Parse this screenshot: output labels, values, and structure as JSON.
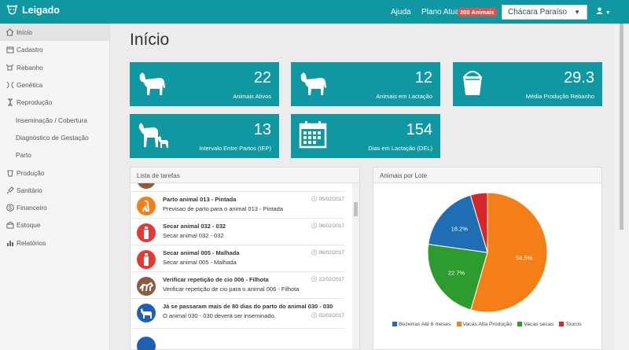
{
  "topbar": {
    "app_name": "Leigado",
    "help": "Ajuda",
    "plan_label": "Plano Atual:",
    "plan_badge": "200 Animais",
    "farm_selected": "Chácara Paraíso"
  },
  "sidebar": {
    "items": [
      {
        "label": "Início",
        "icon": "home-icon"
      },
      {
        "label": "Cadastro",
        "icon": "register-icon"
      },
      {
        "label": "Rebanho",
        "icon": "herd-icon"
      },
      {
        "label": "Genética",
        "icon": "genetics-icon"
      },
      {
        "label": "Reprodução",
        "icon": "reproduction-icon"
      },
      {
        "label": "Inseminação / Cobertura"
      },
      {
        "label": "Diagnóstico de Gestação"
      },
      {
        "label": "Parto"
      },
      {
        "label": "Produção",
        "icon": "production-icon"
      },
      {
        "label": "Sanitário",
        "icon": "syringe-icon"
      },
      {
        "label": "Financeiro",
        "icon": "dollar-icon"
      },
      {
        "label": "Estoque",
        "icon": "stock-icon"
      },
      {
        "label": "Relatórios",
        "icon": "reports-icon"
      }
    ]
  },
  "main": {
    "title": "Início",
    "cards": [
      {
        "value": "22",
        "label": "Animais Ativos",
        "icon": "cow-icon"
      },
      {
        "value": "12",
        "label": "Animais em Lactação",
        "icon": "cow-icon"
      },
      {
        "value": "29.3",
        "label": "Média Produção Rebanho",
        "icon": "bucket-icon"
      },
      {
        "value": "13",
        "label": "Intervalo Entre Partos (IEP)",
        "icon": "cow-calf-icon"
      },
      {
        "value": "154",
        "label": "Dias em Lactação (DEL)",
        "icon": "calendar-icon"
      }
    ]
  },
  "tasks": {
    "title": "Lista de tarefas",
    "items": [
      {
        "title": "Parto animal 013 - Pintada",
        "subtitle": "Previsao de parto para o animal 013 - Pintada",
        "date": "05/02/2017",
        "color": "#f57f17",
        "icon": "birth-icon"
      },
      {
        "title": "Secar animal 032 - 032",
        "subtitle": "Secar animal 032 - 032",
        "date": "06/02/2017",
        "color": "#e53935",
        "icon": "bottle-icon"
      },
      {
        "title": "Secar animal 005 - Malhada",
        "subtitle": "Secar animal 005 - Malhada",
        "date": "06/02/2017",
        "color": "#e53935",
        "icon": "bottle-icon"
      },
      {
        "title": "Verificar repetição de cio 006 - Filhota",
        "subtitle": "Verificar repetição de cio para o animal 006 - Filhota",
        "date": "22/02/2017",
        "color": "#8d5b43",
        "icon": "mating-icon"
      },
      {
        "title": "Já se passaram mais de 80 dias do parto do animal 030 - 030",
        "subtitle": "O animal 030 - 030 deverá ser inseminado.",
        "date": "02/03/2017",
        "color": "#1f5fb8",
        "icon": "cow-icon"
      }
    ]
  },
  "lot_chart": {
    "title": "Animais por Lote",
    "chart_data": {
      "type": "pie",
      "slices": [
        {
          "name": "Bezerras Até 6 meses",
          "value": 18.2,
          "label": "18.2%",
          "color": "#1f6db3"
        },
        {
          "name": "Vacas Alta Produção",
          "value": 54.5,
          "label": "54.5%",
          "color": "#f57f17"
        },
        {
          "name": "Vacas secas",
          "value": 22.7,
          "label": "22.7%",
          "color": "#2e9b2e"
        },
        {
          "name": "Touros",
          "value": 4.6,
          "label": "",
          "color": "#d62728"
        }
      ]
    }
  }
}
